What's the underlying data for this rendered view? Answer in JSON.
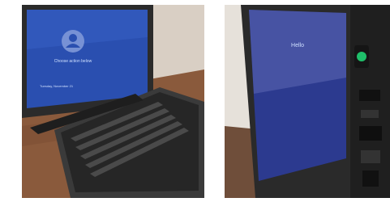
{
  "photos": [
    {
      "id": "left",
      "subject": "rugged tablet with detachable keyboard on a wooden desk",
      "screen": {
        "greeting": "Choose action below",
        "date": "Tuesday, November 21",
        "screen_color": "#2a4fb0"
      },
      "desk_color": "#8a5a3c",
      "device_color": "#2b2b2b"
    },
    {
      "id": "right",
      "subject": "side view of rugged tablet showing ports",
      "screen": {
        "title": "Hello",
        "screen_color": "#2c3a8f"
      },
      "desk_color": "#6f4e3a",
      "accent": "#1fbf6a"
    }
  ]
}
